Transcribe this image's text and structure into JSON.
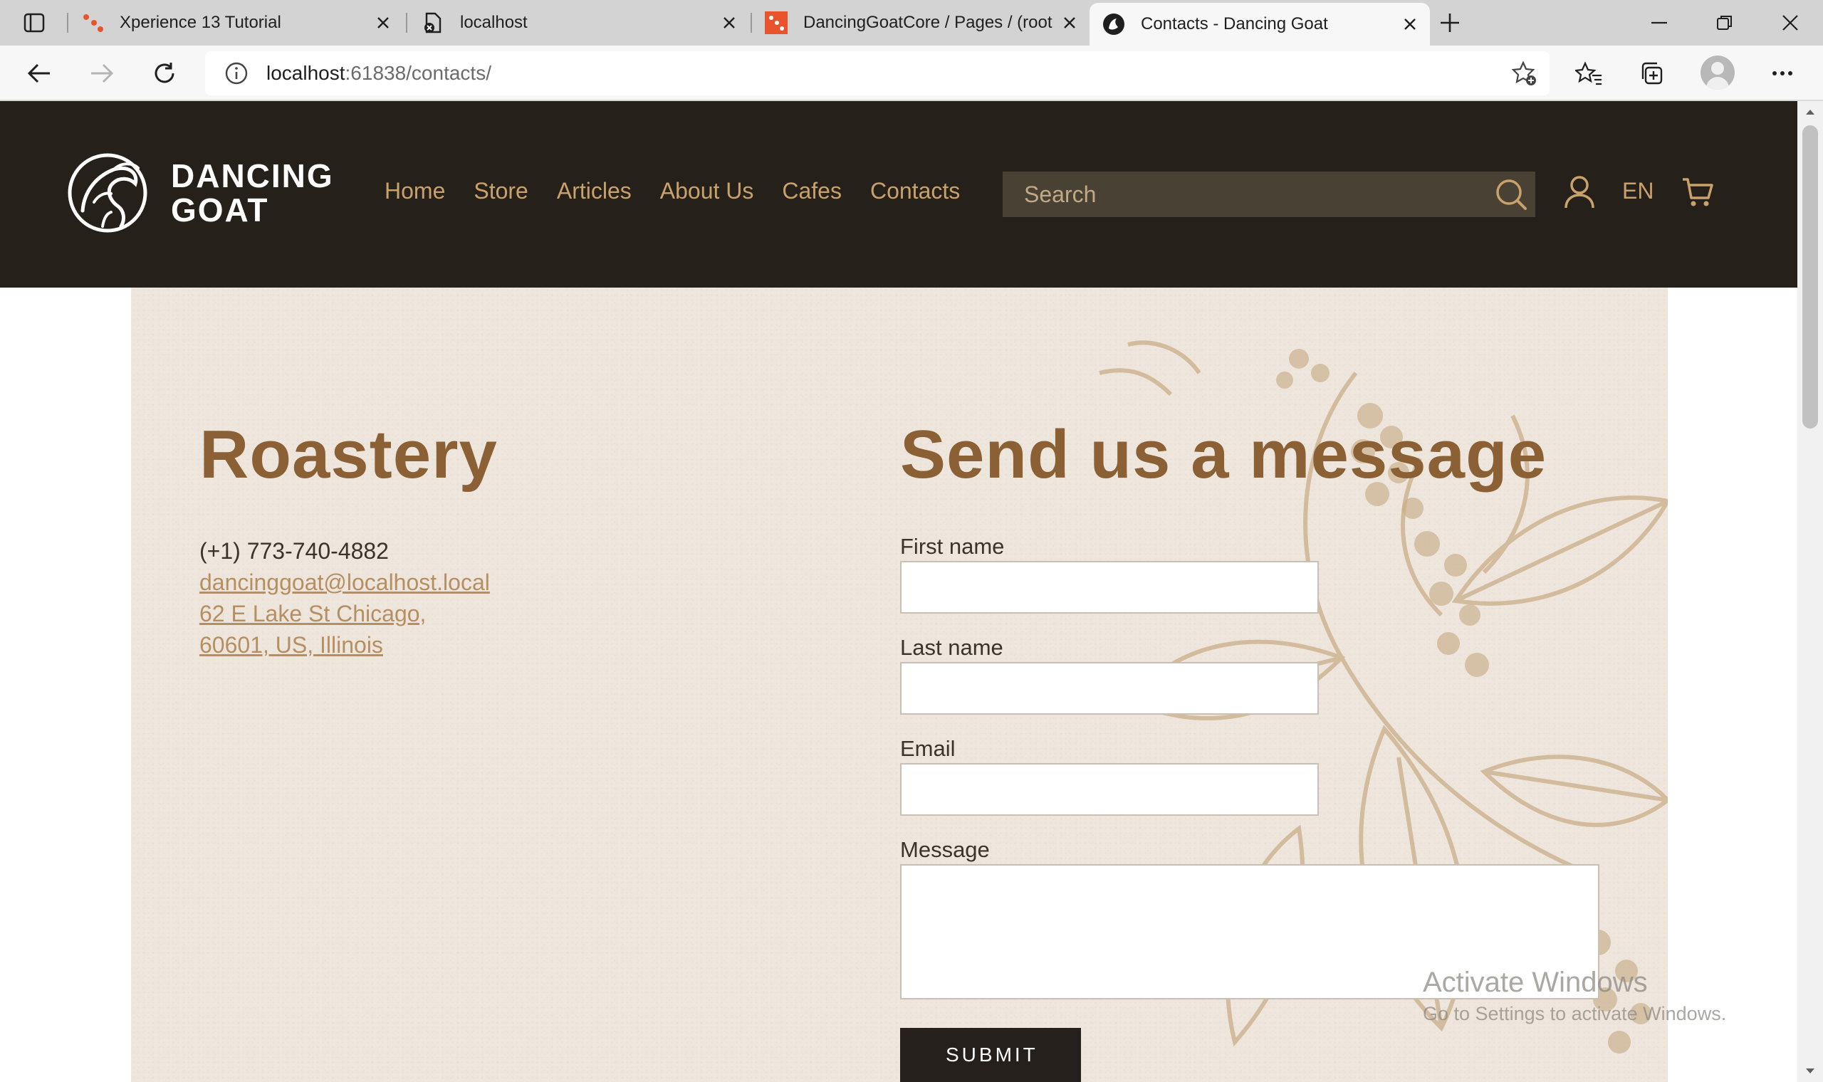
{
  "browser": {
    "tabs": [
      {
        "title": "Xperience 13 Tutorial",
        "active": false
      },
      {
        "title": "localhost",
        "active": false
      },
      {
        "title": "DancingGoatCore / Pages / (root",
        "active": false
      },
      {
        "title": "Contacts - Dancing Goat",
        "active": true
      }
    ],
    "address": {
      "host": "localhost",
      "path": ":61838/contacts/"
    },
    "icons": {
      "tab_actions": "tab-actions-icon",
      "back": "back-arrow-icon",
      "forward": "forward-arrow-icon",
      "refresh": "refresh-icon",
      "info": "info-icon",
      "add_favorite": "add-favorite-icon",
      "favorites": "favorites-icon",
      "collections": "collections-icon",
      "profile": "profile-avatar",
      "menu": "more-menu-icon"
    }
  },
  "site": {
    "logo_line1": "DANCING",
    "logo_line2": "GOAT",
    "nav": [
      "Home",
      "Store",
      "Articles",
      "About Us",
      "Cafes",
      "Contacts"
    ],
    "search_placeholder": "Search",
    "lang": "EN",
    "colors": {
      "header_bg": "#26201a",
      "accent": "#c9a26b",
      "heading": "#8a6034",
      "content_bg": "#eee6dc"
    }
  },
  "roastery": {
    "heading": "Roastery",
    "phone": "(+1) 773-740-4882",
    "email": "dancinggoat@localhost.local",
    "address_line1": "62 E Lake St Chicago,",
    "address_line2": "60601, US, Illinois"
  },
  "form": {
    "heading": "Send us a message",
    "first_name_label": "First name",
    "first_name_value": "",
    "last_name_label": "Last name",
    "last_name_value": "",
    "email_label": "Email",
    "email_value": "",
    "message_label": "Message",
    "message_value": "",
    "submit_label": "SUBMIT"
  },
  "watermark": {
    "line1": "Activate Windows",
    "line2": "Go to Settings to activate Windows."
  }
}
